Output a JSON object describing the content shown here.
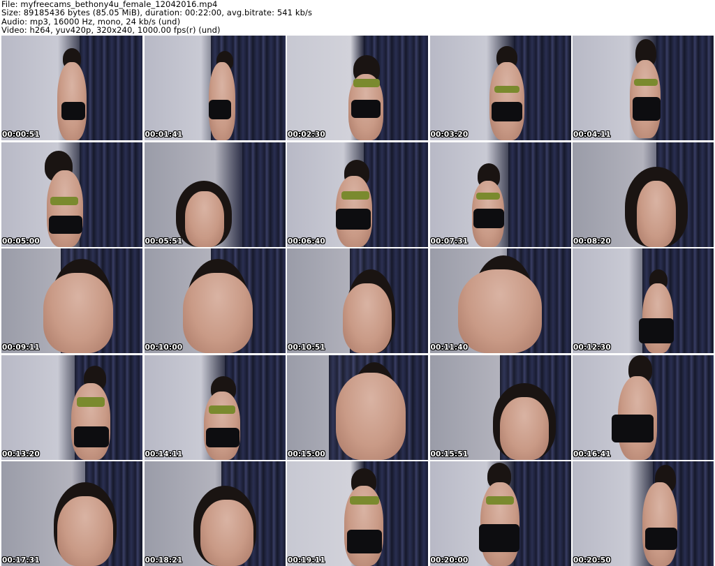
{
  "header": {
    "file_line": "File: myfreecams_bethony4u_female_12042016.mp4",
    "size_line": "Size: 89185436 bytes (85.05 MiB), duration: 00:22:00, avg.bitrate: 541 kb/s",
    "audio_line": "Audio: mp3, 16000 Hz, mono, 24 kb/s (und)",
    "video_line": "Video: h264, yuv420p, 320x240, 1000.00 fps(r) (und)"
  },
  "thumbnails": [
    {
      "timestamp": "00:00:51"
    },
    {
      "timestamp": "00:01:41"
    },
    {
      "timestamp": "00:02:30"
    },
    {
      "timestamp": "00:03:20"
    },
    {
      "timestamp": "00:04:11"
    },
    {
      "timestamp": "00:05:00"
    },
    {
      "timestamp": "00:05:51"
    },
    {
      "timestamp": "00:06:40"
    },
    {
      "timestamp": "00:07:31"
    },
    {
      "timestamp": "00:08:20"
    },
    {
      "timestamp": "00:09:11"
    },
    {
      "timestamp": "00:10:00"
    },
    {
      "timestamp": "00:10:51"
    },
    {
      "timestamp": "00:11:40"
    },
    {
      "timestamp": "00:12:30"
    },
    {
      "timestamp": "00:13:20"
    },
    {
      "timestamp": "00:14:11"
    },
    {
      "timestamp": "00:15:00"
    },
    {
      "timestamp": "00:15:51"
    },
    {
      "timestamp": "00:16:41"
    },
    {
      "timestamp": "00:17:31"
    },
    {
      "timestamp": "00:18:21"
    },
    {
      "timestamp": "00:19:11"
    },
    {
      "timestamp": "00:20:00"
    },
    {
      "timestamp": "00:20:50"
    }
  ]
}
